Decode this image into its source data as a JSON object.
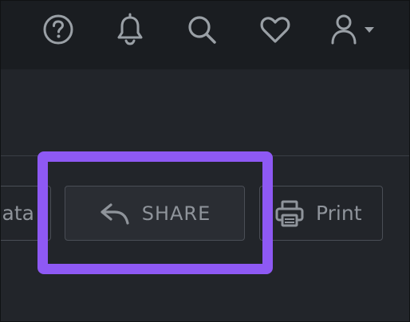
{
  "header": {
    "icons": [
      {
        "name": "help-icon"
      },
      {
        "name": "bell-icon"
      },
      {
        "name": "search-icon"
      },
      {
        "name": "heart-icon"
      },
      {
        "name": "user-icon"
      }
    ]
  },
  "actions": {
    "data_label": "ata",
    "share_label": "SHARE",
    "print_label": "Print"
  },
  "colors": {
    "background": "#22252a",
    "topbar": "#1a1d21",
    "icon": "#9aa0a6",
    "highlight": "#8e59f4"
  }
}
